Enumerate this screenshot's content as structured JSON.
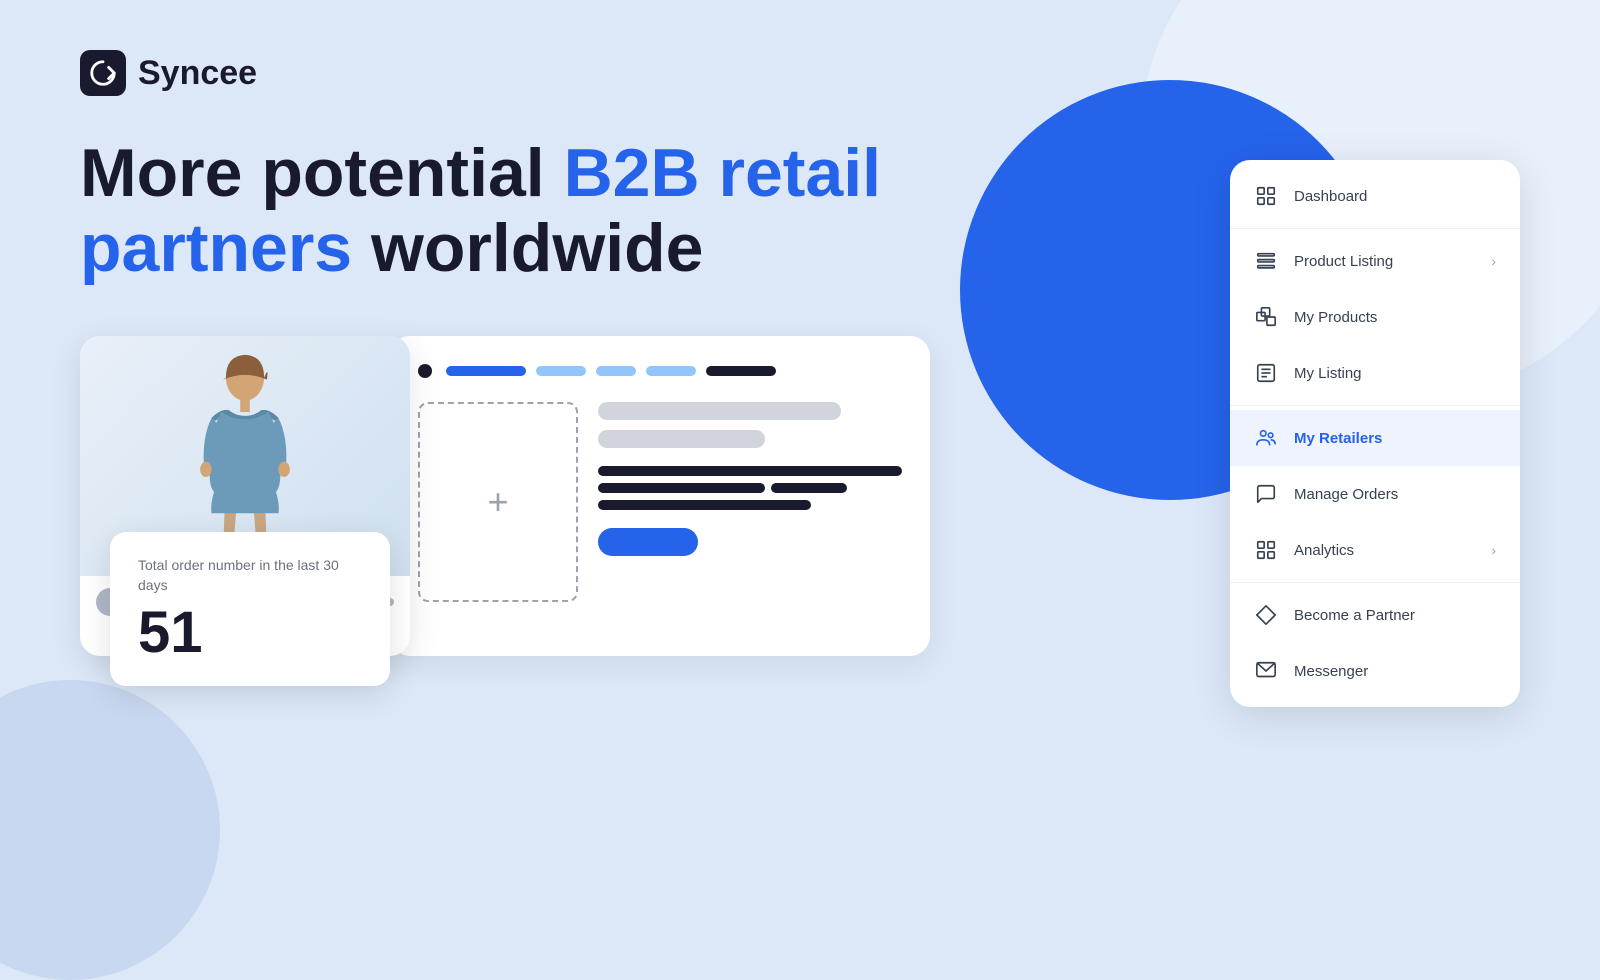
{
  "logo": {
    "text": "Syncee"
  },
  "headline": {
    "part1": "More potential ",
    "highlight1": "B2B retail",
    "part2": " ",
    "highlight2": "partners",
    "part3": " worldwide"
  },
  "stats_card": {
    "label": "Total order number in the last 30 days",
    "number": "51"
  },
  "nav": {
    "items": [
      {
        "id": "dashboard",
        "label": "Dashboard",
        "icon": "dashboard-icon",
        "chevron": false,
        "active": false
      },
      {
        "id": "product-listing",
        "label": "Product Listing",
        "icon": "list-icon",
        "chevron": true,
        "active": false
      },
      {
        "id": "my-products",
        "label": "My Products",
        "icon": "products-icon",
        "chevron": false,
        "active": false
      },
      {
        "id": "my-listing",
        "label": "My Listing",
        "icon": "listing-icon",
        "chevron": false,
        "active": false
      },
      {
        "id": "my-retailers",
        "label": "My Retailers",
        "icon": "retailers-icon",
        "chevron": false,
        "active": true
      },
      {
        "id": "manage-orders",
        "label": "Manage Orders",
        "icon": "orders-icon",
        "chevron": false,
        "active": false
      },
      {
        "id": "analytics",
        "label": "Analytics",
        "icon": "analytics-icon",
        "chevron": true,
        "active": false
      },
      {
        "id": "become-partner",
        "label": "Become a Partner",
        "icon": "partner-icon",
        "chevron": false,
        "active": false
      },
      {
        "id": "messenger",
        "label": "Messenger",
        "icon": "messenger-icon",
        "chevron": false,
        "active": false
      }
    ]
  }
}
